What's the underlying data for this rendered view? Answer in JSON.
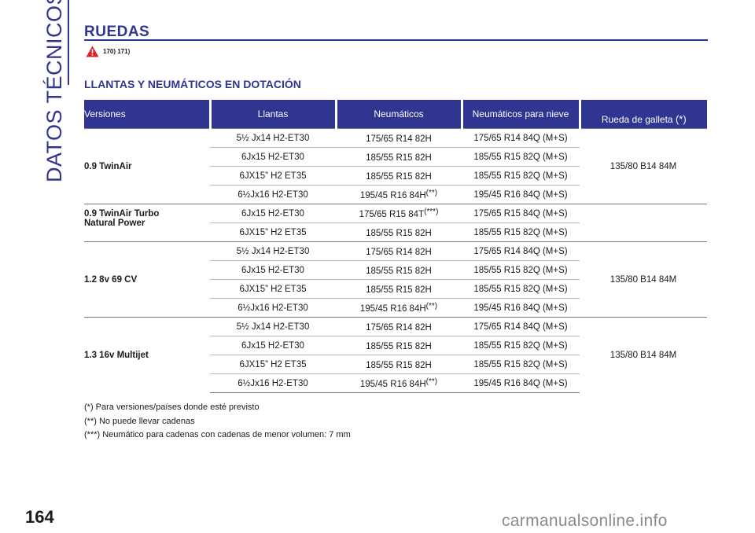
{
  "side_label": "DATOS TÉCNICOS",
  "section_title": "RUEDAS",
  "warning_refs": "170) 171)",
  "subtitle": "LLANTAS Y NEUMÁTICOS EN DOTACIÓN",
  "headers": {
    "versions": "Versiones",
    "rims": "Llantas",
    "tyres": "Neumáticos",
    "snow_tyres": "Neumáticos para nieve",
    "spare": "Rueda de galleta",
    "spare_mark": "(*)"
  },
  "groups": [
    {
      "version": "0.9 TwinAir",
      "spare": "135/80 B14 84M",
      "rows": [
        {
          "rim": "5½ Jx14 H2-ET30",
          "tyre": "175/65 R14 82H",
          "tyre_mark": "",
          "snow": "175/65 R14 84Q (M+S)"
        },
        {
          "rim": "6Jx15 H2-ET30",
          "tyre": "185/55 R15 82H",
          "tyre_mark": "",
          "snow": "185/55 R15 82Q (M+S)"
        },
        {
          "rim": "6JX15” H2 ET35",
          "tyre": "185/55 R15 82H",
          "tyre_mark": "",
          "snow": "185/55 R15 82Q (M+S)"
        },
        {
          "rim": "6½Jx16 H2-ET30",
          "tyre": "195/45 R16 84H",
          "tyre_mark": "(**)",
          "snow": "195/45 R16 84Q (M+S)"
        }
      ]
    },
    {
      "version_line1": "0.9 TwinAir Turbo",
      "version_line2": "Natural Power",
      "spare": "",
      "rows": [
        {
          "rim": "6Jx15 H2-ET30",
          "tyre": "175/65 R15 84T",
          "tyre_mark": "(***)",
          "snow": "175/65 R15 84Q (M+S)"
        },
        {
          "rim": "6JX15” H2 ET35",
          "tyre": "185/55 R15 82H",
          "tyre_mark": "",
          "snow": "185/55 R15 82Q (M+S)"
        }
      ]
    },
    {
      "version": "1.2 8v 69 CV",
      "spare": "135/80 B14 84M",
      "rows": [
        {
          "rim": "5½ Jx14 H2-ET30",
          "tyre": "175/65 R14 82H",
          "tyre_mark": "",
          "snow": "175/65 R14 84Q (M+S)"
        },
        {
          "rim": "6Jx15 H2-ET30",
          "tyre": "185/55 R15 82H",
          "tyre_mark": "",
          "snow": "185/55 R15 82Q (M+S)"
        },
        {
          "rim": "6JX15” H2 ET35",
          "tyre": "185/55 R15 82H",
          "tyre_mark": "",
          "snow": "185/55 R15 82Q (M+S)"
        },
        {
          "rim": "6½Jx16 H2-ET30",
          "tyre": "195/45 R16 84H",
          "tyre_mark": "(**)",
          "snow": "195/45 R16 84Q (M+S)"
        }
      ]
    },
    {
      "version": "1.3 16v Multijet",
      "spare": "135/80 B14 84M",
      "rows": [
        {
          "rim": "5½ Jx14 H2-ET30",
          "tyre": "175/65 R14 82H",
          "tyre_mark": "",
          "snow": "175/65 R14 84Q (M+S)"
        },
        {
          "rim": "6Jx15 H2-ET30",
          "tyre": "185/55 R15 82H",
          "tyre_mark": "",
          "snow": "185/55 R15 82Q (M+S)"
        },
        {
          "rim": "6JX15” H2 ET35",
          "tyre": "185/55 R15 82H",
          "tyre_mark": "",
          "snow": "185/55 R15 82Q (M+S)"
        },
        {
          "rim": "6½Jx16 H2-ET30",
          "tyre": "195/45 R16 84H",
          "tyre_mark": "(**)",
          "snow": "195/45 R16 84Q (M+S)"
        }
      ]
    }
  ],
  "notes": [
    "(*) Para versiones/países donde esté previsto",
    "(**) No puede llevar cadenas",
    "(***) Neumático para cadenas con cadenas de menor volumen: 7 mm"
  ],
  "page_number": "164",
  "watermark": "carmanualsonline.info",
  "colors": {
    "accent": "#2f3590",
    "warning": "#d9232d"
  },
  "icons": [
    "warning-triangle-icon"
  ]
}
